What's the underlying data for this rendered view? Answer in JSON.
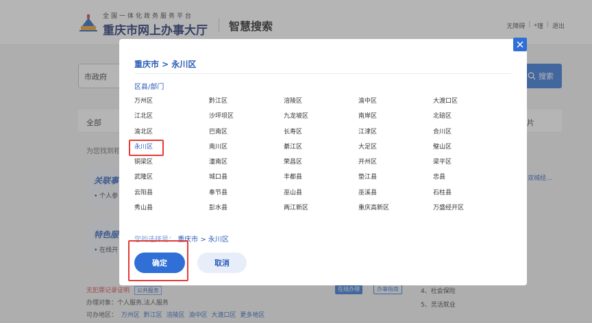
{
  "header": {
    "logo_small": "全国一体化政务服务平台",
    "logo_big": "重庆市网上办事大厅",
    "title": "智慧搜索",
    "links": [
      "无障碍",
      "*瑾",
      "退出"
    ]
  },
  "search": {
    "value": "市政府",
    "button_label": "搜索"
  },
  "filter": {
    "all_label": "全部",
    "right_label": "片"
  },
  "results": {
    "count_text": "为您找到相",
    "cards": [
      {
        "title": "关联事",
        "sub": "• 个人参"
      },
      {
        "title": "特色服",
        "sub": "• 在线开"
      }
    ],
    "right_link": "双城经..."
  },
  "bottom": {
    "item_title": "无犯罪记录证明",
    "item_tag": "公共服务",
    "audience": "办理对象：个人服务,法人服务",
    "areas_label": "可办地区：",
    "areas": [
      "万州区",
      "黔江区",
      "涪陵区",
      "渝中区",
      "大渡口区",
      "更多地区"
    ],
    "btn_online": "在线办理",
    "btn_guide": "办事指南",
    "side_items": [
      "4、社会保险",
      "5、灵活就业"
    ]
  },
  "modal": {
    "breadcrumb": "重庆市 > 永川区",
    "section_label": "区县/部门",
    "districts": [
      "万州区",
      "黔江区",
      "涪陵区",
      "渝中区",
      "大渡口区",
      "江北区",
      "沙坪坝区",
      "九龙坡区",
      "南岸区",
      "北碚区",
      "渝北区",
      "巴南区",
      "长寿区",
      "江津区",
      "合川区",
      "永川区",
      "南川区",
      "綦江区",
      "大足区",
      "璧山区",
      "铜梁区",
      "潼南区",
      "荣昌区",
      "开州区",
      "梁平区",
      "武隆区",
      "城口县",
      "丰都县",
      "垫江县",
      "忠县",
      "云阳县",
      "奉节县",
      "巫山县",
      "巫溪县",
      "石柱县",
      "秀山县",
      "彭水县",
      "两江新区",
      "重庆高新区",
      "万盛经开区"
    ],
    "selected_district": "永川区",
    "selection_label": "您的选择是：",
    "selection_value": "重庆市 > 永川区",
    "confirm_label": "确定",
    "cancel_label": "取消"
  },
  "colors": {
    "primary": "#2f6fd6",
    "highlight": "#e53935"
  }
}
